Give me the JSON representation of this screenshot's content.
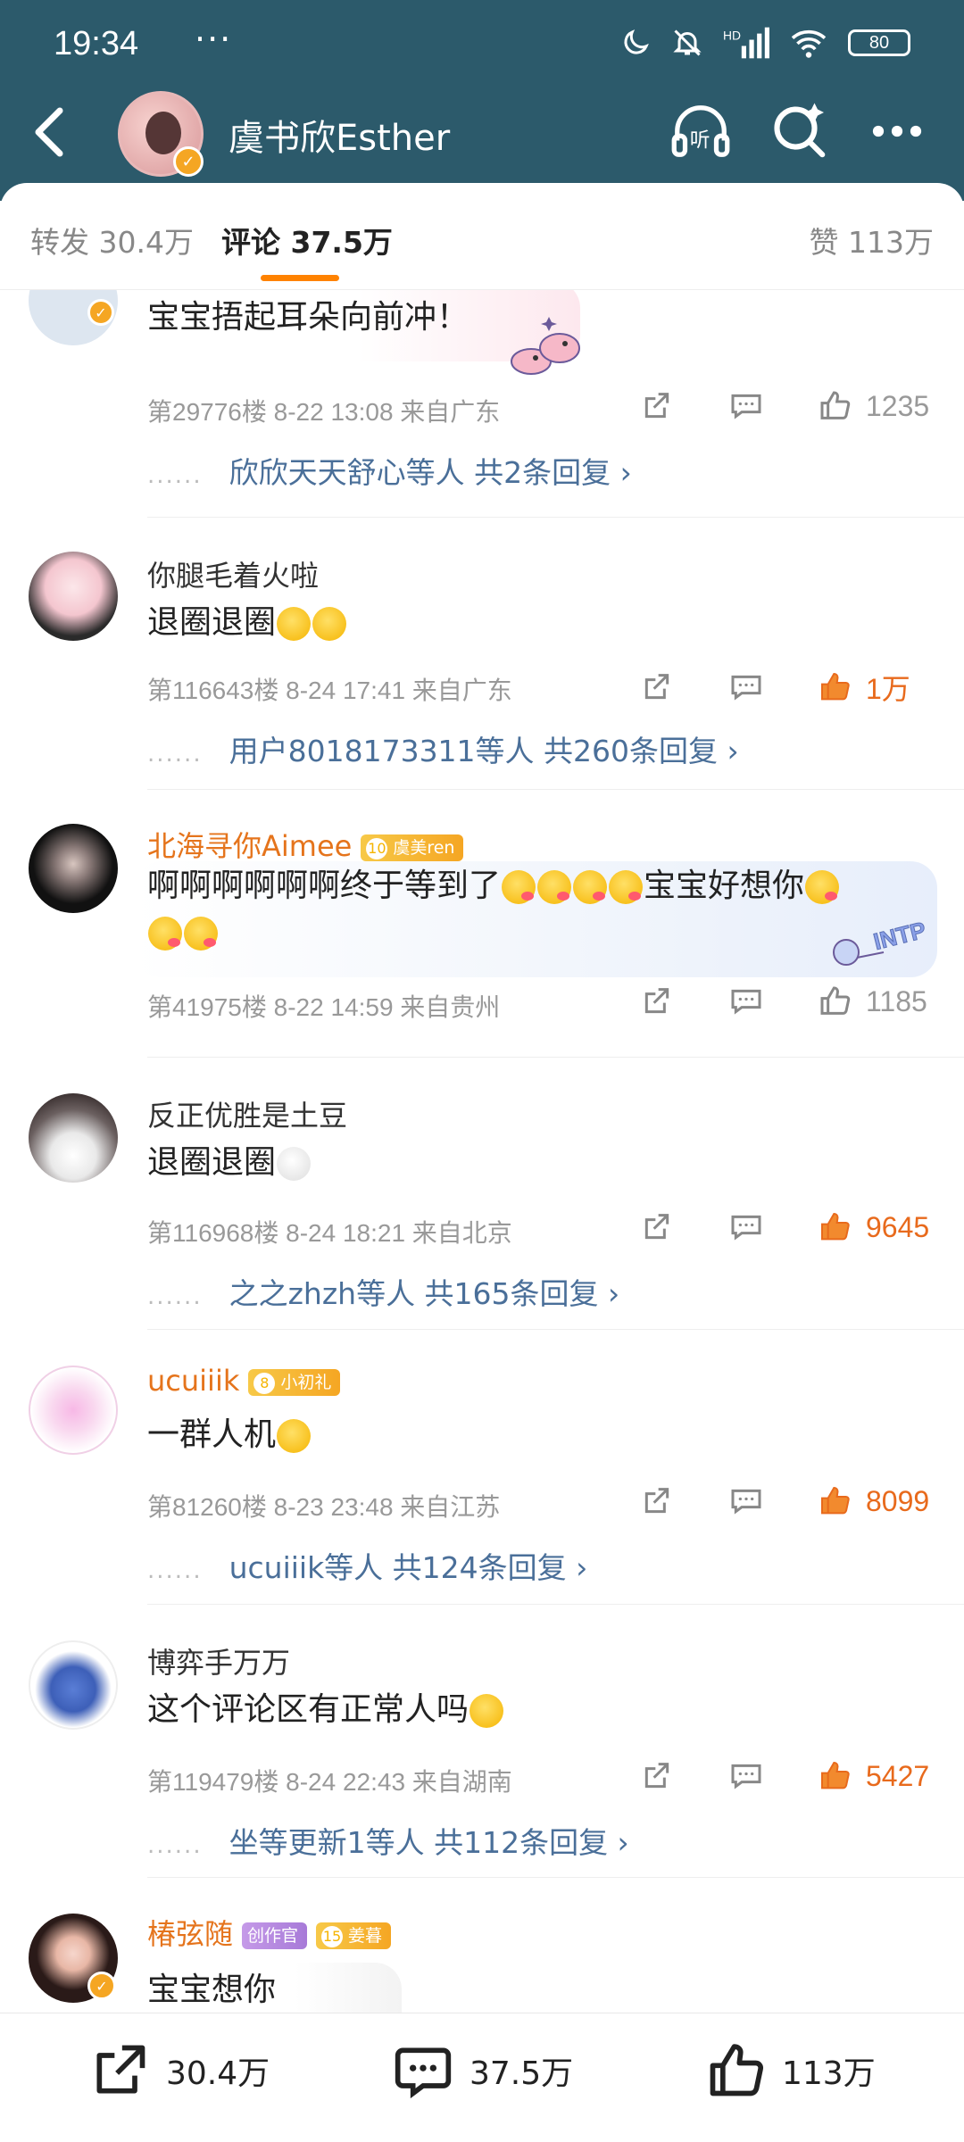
{
  "status_bar": {
    "time": "19:34",
    "dots": "···",
    "signal_label": "HD",
    "battery": "80"
  },
  "header": {
    "title": "虞书欣Esther",
    "listen_label": "听"
  },
  "tabs": {
    "repost": "转发 30.4万",
    "comments": "评论 37.5万",
    "likes": "赞 113万"
  },
  "comments": [
    {
      "author": "",
      "text": "宝宝捂起耳朵向前冲！",
      "floor": "第29776楼 8-22 13:08 来自广东",
      "likes": "1235",
      "replies": "欣欣天天舒心等人 共2条回复 ›"
    },
    {
      "author": "你腿毛着火啦",
      "text": "退圈退圈",
      "floor": "第116643楼 8-24 17:41 来自广东",
      "likes": "1万",
      "replies": "用户8018173311等人 共260条回复 ›"
    },
    {
      "author": "北海寻你Aimee",
      "badge": "虞美ren",
      "badge_level": "10",
      "text": "啊啊啊啊啊啊终于等到了",
      "text2": "宝宝好想你",
      "floor": "第41975楼 8-22 14:59 来自贵州",
      "likes": "1185",
      "sticker": "INTP"
    },
    {
      "author": "反正优胜是土豆",
      "text": "退圈退圈",
      "floor": "第116968楼 8-24 18:21 来自北京",
      "likes": "9645",
      "replies": "之之zhzh等人 共165条回复 ›"
    },
    {
      "author": "ucuiiik",
      "badge": "小初礼",
      "badge_level": "8",
      "text": "一群人机",
      "floor": "第81260楼 8-23 23:48 来自江苏",
      "likes": "8099",
      "replies": "ucuiiik等人 共124条回复 ›"
    },
    {
      "author": "博弈手万万",
      "text": "这个评论区有正常人吗",
      "floor": "第119479楼 8-24 22:43 来自湖南",
      "likes": "5427",
      "replies": "坐等更新1等人 共112条回复 ›"
    },
    {
      "author": "椿弦随",
      "badge": "创作官",
      "badge2": "姜暮",
      "badge2_level": "15",
      "text": "宝宝想你"
    }
  ],
  "bottom_bar": {
    "repost": "30.4万",
    "comment": "37.5万",
    "like": "113万"
  },
  "colors": {
    "header_bg": "#2c5a6b",
    "accent": "#ff8200",
    "link": "#4a6f99",
    "vip_name": "#e5741c"
  }
}
